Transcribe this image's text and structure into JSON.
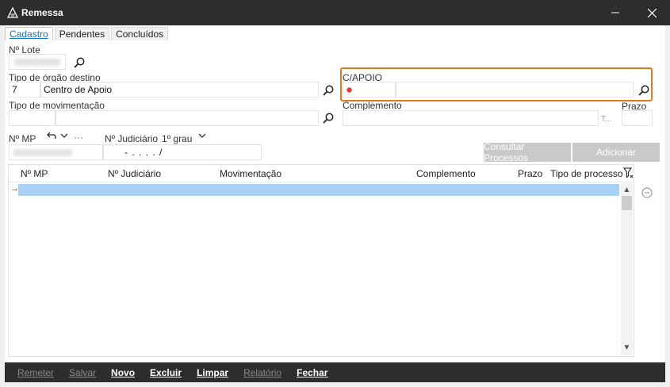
{
  "window": {
    "title": "Remessa"
  },
  "tabs": [
    {
      "label": "Cadastro",
      "active": true
    },
    {
      "label": "Pendentes",
      "active": false
    },
    {
      "label": "Concluídos",
      "active": false
    }
  ],
  "form": {
    "lote_label": "Nº Lote",
    "tipo_orgao_label": "Tipo de órgão destino",
    "tipo_orgao_code": "7",
    "tipo_orgao_value": "Centro de Apoio",
    "capoio_label": "C/APOIO",
    "tipo_mov_label": "Tipo de movimentação",
    "complemento_label": "Complemento",
    "complemento_hint": "T...",
    "prazo_label": "Prazo",
    "nmp_label": "Nº MP",
    "njud_label": "Nº Judiciário",
    "grau_value": "1º grau",
    "njud_mask": "- .   . . .   /",
    "more_dots": "···"
  },
  "actions": {
    "consultar": "Consultar Processos",
    "adicionar": "Adicionar"
  },
  "grid": {
    "columns": [
      "Nº MP",
      "Nº Judiciário",
      "Movimentação",
      "Complemento",
      "Prazo",
      "Tipo de processo"
    ],
    "row_indicator": "→"
  },
  "footer": {
    "buttons": [
      {
        "label": "Remeter",
        "enabled": false
      },
      {
        "label": "Salvar",
        "enabled": false
      },
      {
        "label": "Novo",
        "enabled": true
      },
      {
        "label": "Excluir",
        "enabled": true
      },
      {
        "label": "Limpar",
        "enabled": true
      },
      {
        "label": "Relatório",
        "enabled": false
      },
      {
        "label": "Fechar",
        "enabled": true
      }
    ]
  },
  "colors": {
    "accent": "#e07b1c",
    "selection": "#a8d2f3",
    "titlebar": "#2d2d2d",
    "required_dot": "#e53935"
  }
}
